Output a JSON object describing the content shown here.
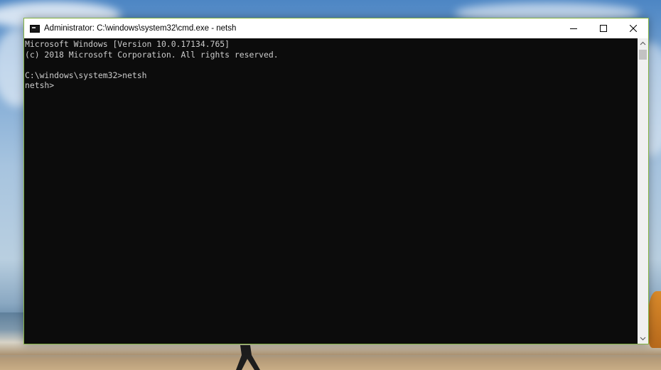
{
  "window": {
    "title": "Administrator: C:\\windows\\system32\\cmd.exe - netsh",
    "minimize_icon": "minimize-icon",
    "maximize_icon": "maximize-icon",
    "close_icon": "close-icon"
  },
  "console": {
    "lines": [
      "Microsoft Windows [Version 10.0.17134.765]",
      "(c) 2018 Microsoft Corporation. All rights reserved.",
      "",
      "C:\\windows\\system32>netsh",
      "netsh>"
    ]
  },
  "colors": {
    "console_background": "#0c0c0c",
    "console_text": "#cccccc",
    "window_border": "#83b342",
    "titlebar": "#ffffff"
  }
}
